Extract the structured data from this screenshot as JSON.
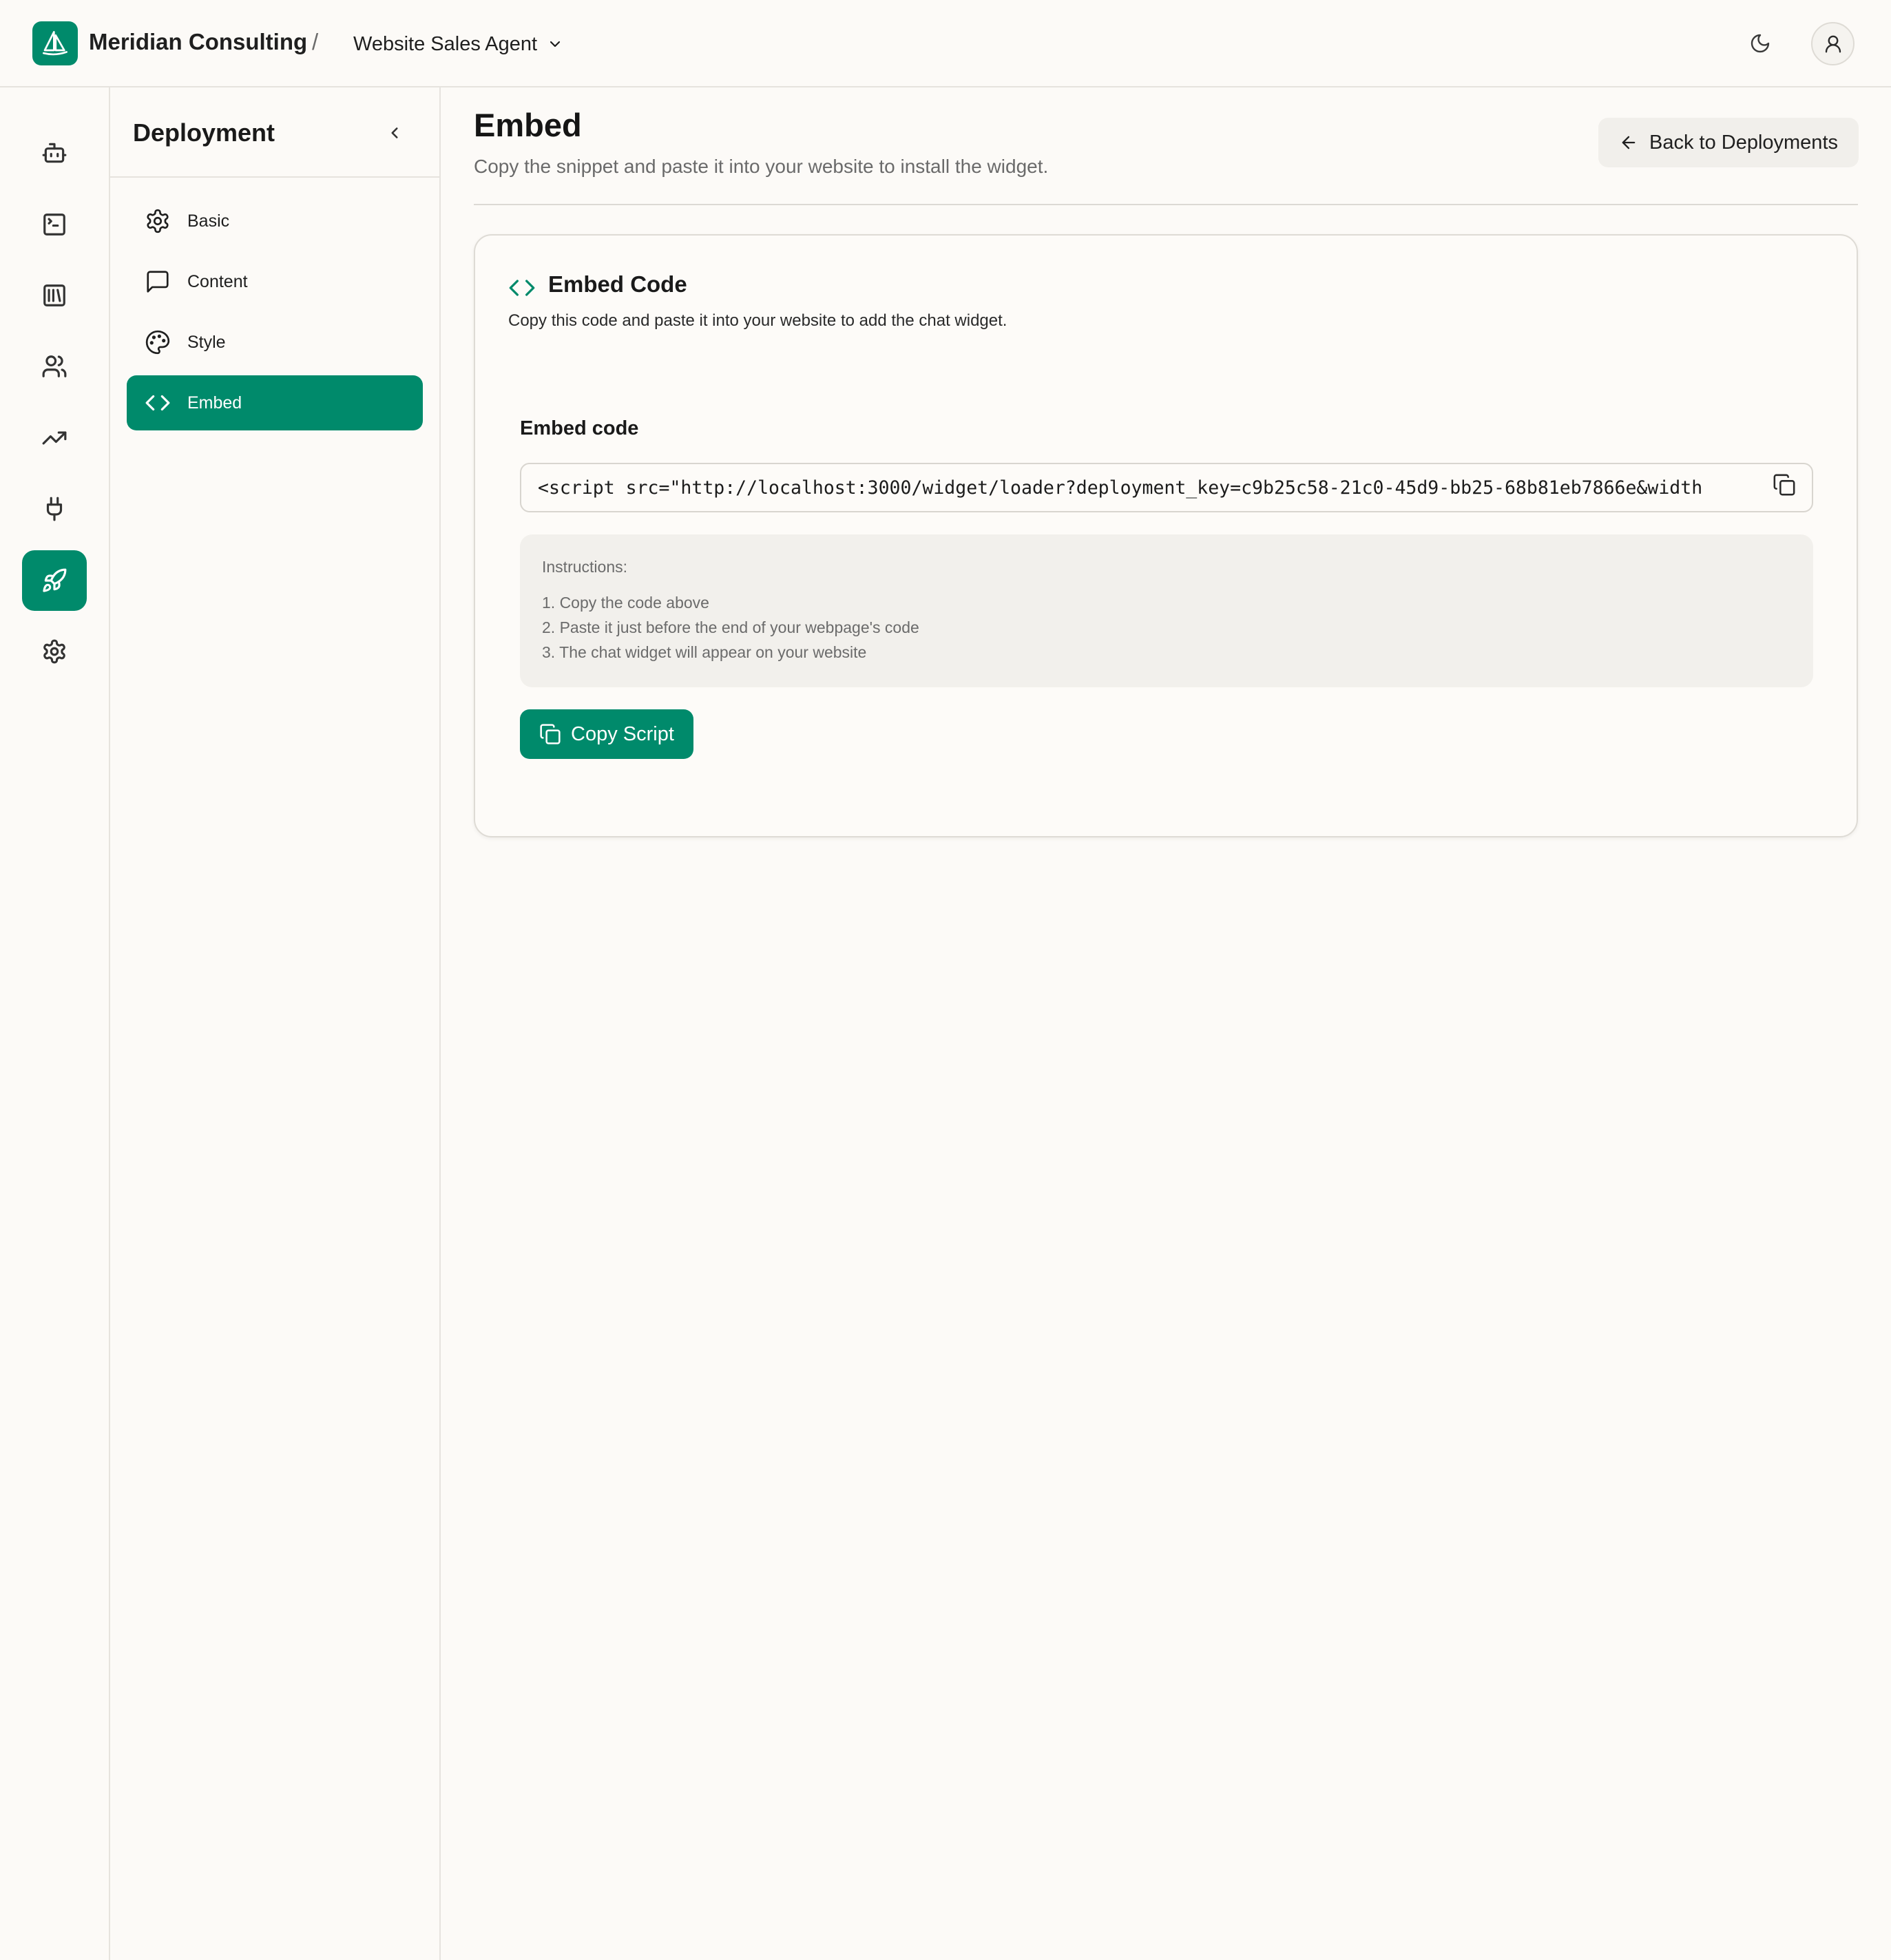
{
  "header": {
    "org_name": "Meridian Consulting",
    "separator": "/",
    "agent_name": "Website Sales Agent"
  },
  "rail": {
    "items": [
      {
        "icon": "bot-icon",
        "active": false
      },
      {
        "icon": "terminal-icon",
        "active": false
      },
      {
        "icon": "library-icon",
        "active": false
      },
      {
        "icon": "users-icon",
        "active": false
      },
      {
        "icon": "trending-up-icon",
        "active": false
      },
      {
        "icon": "plug-icon",
        "active": false
      },
      {
        "icon": "rocket-icon",
        "active": true
      },
      {
        "icon": "settings-icon",
        "active": false
      }
    ]
  },
  "subnav": {
    "title": "Deployment",
    "items": [
      {
        "label": "Basic",
        "icon": "settings-icon",
        "active": false
      },
      {
        "label": "Content",
        "icon": "message-square-icon",
        "active": false
      },
      {
        "label": "Style",
        "icon": "palette-icon",
        "active": false
      },
      {
        "label": "Embed",
        "icon": "code-icon",
        "active": true
      }
    ]
  },
  "main": {
    "title": "Embed",
    "subtitle": "Copy the snippet and paste it into your website to install the widget.",
    "back_label": "Back to Deployments"
  },
  "card": {
    "title": "Embed Code",
    "description": "Copy this code and paste it into your website to add the chat widget.",
    "field_label": "Embed code",
    "code": "<script src=\"http://localhost:3000/widget/loader?deployment_key=c9b25c58-21c0-45d9-bb25-68b81eb7866e&width",
    "instructions_title": "Instructions:",
    "instructions": [
      "1. Copy the code above",
      "2. Paste it just before the end of your webpage's code",
      "3. The chat widget will appear on your website"
    ],
    "copy_label": "Copy Script"
  },
  "colors": {
    "accent": "#008a6b",
    "background": "#fcfaf7",
    "border": "#e6e3de"
  }
}
